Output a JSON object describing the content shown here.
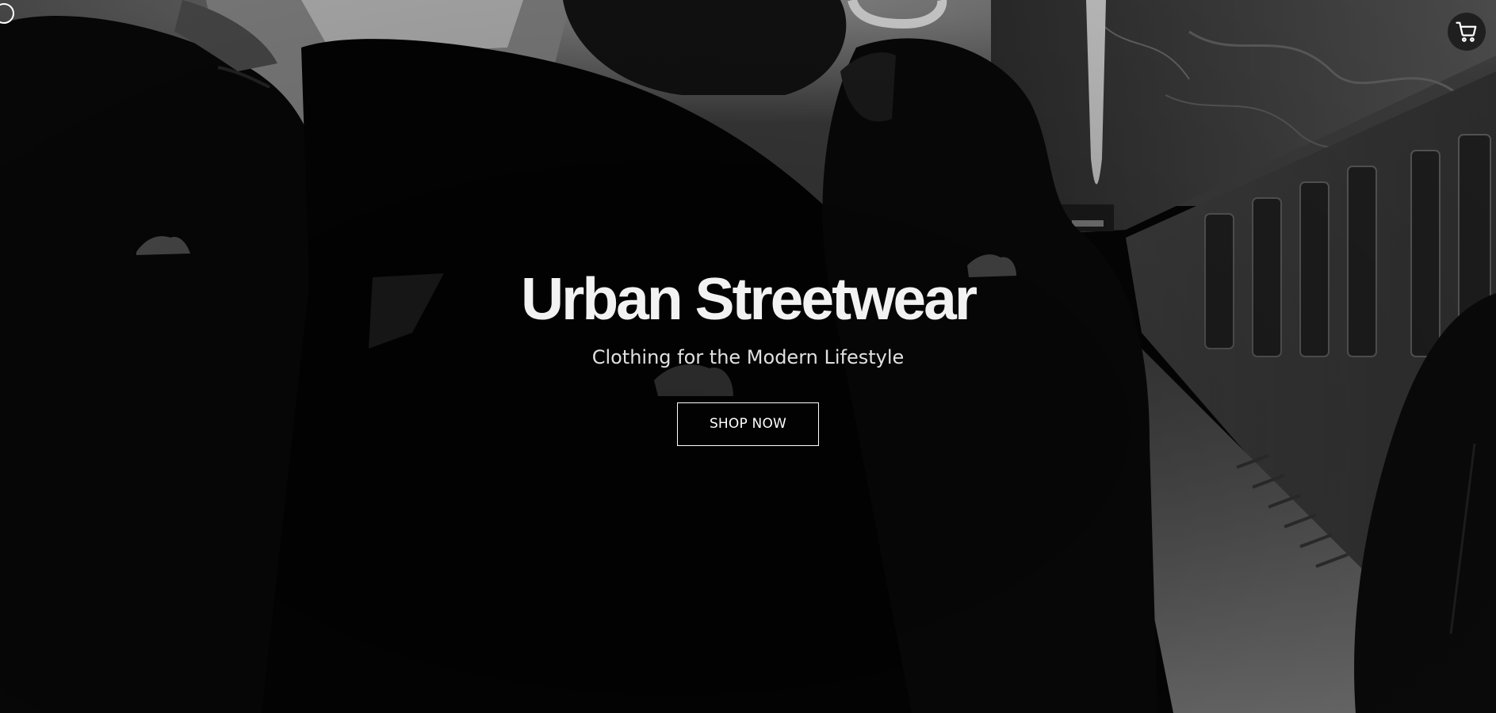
{
  "header": {
    "menu_icon": "circle-outline-icon",
    "cart_icon": "shopping-cart-icon"
  },
  "hero": {
    "title": "Urban Streetwear",
    "subtitle": "Clothing for the Modern Lifestyle",
    "cta_label": "SHOP NOW",
    "background_image": "grayscale-photo-crowd-subway-platform"
  },
  "colors": {
    "text_primary": "#f2f2f2",
    "text_secondary": "#e0e0e0",
    "cart_button_bg": "#1f1f1f",
    "page_bg": "#000000"
  }
}
